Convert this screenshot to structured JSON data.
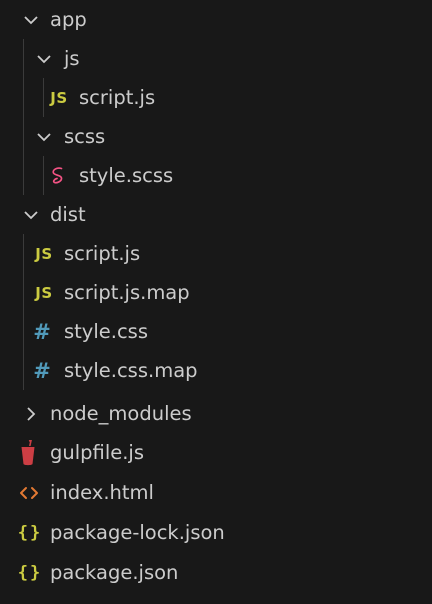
{
  "explorer": {
    "items": [
      {
        "label": "app",
        "type": "folder",
        "state": "expanded",
        "icon": "chevron-down-icon"
      },
      {
        "label": "js",
        "type": "folder",
        "state": "expanded",
        "icon": "chevron-down-icon"
      },
      {
        "label": "script.js",
        "type": "file",
        "icon": "javascript-file-icon",
        "icon_text": "JS"
      },
      {
        "label": "scss",
        "type": "folder",
        "state": "expanded",
        "icon": "chevron-down-icon"
      },
      {
        "label": "style.scss",
        "type": "file",
        "icon": "sass-file-icon"
      },
      {
        "label": "dist",
        "type": "folder",
        "state": "expanded",
        "icon": "chevron-down-icon"
      },
      {
        "label": "script.js",
        "type": "file",
        "icon": "javascript-file-icon",
        "icon_text": "JS"
      },
      {
        "label": "script.js.map",
        "type": "file",
        "icon": "javascript-file-icon",
        "icon_text": "JS"
      },
      {
        "label": "style.css",
        "type": "file",
        "icon": "css-file-icon",
        "icon_text": "#"
      },
      {
        "label": "style.css.map",
        "type": "file",
        "icon": "css-file-icon",
        "icon_text": "#"
      },
      {
        "label": "node_modules",
        "type": "folder",
        "state": "collapsed",
        "icon": "chevron-right-icon"
      },
      {
        "label": "gulpfile.js",
        "type": "file",
        "icon": "gulp-file-icon"
      },
      {
        "label": "index.html",
        "type": "file",
        "icon": "html-file-icon"
      },
      {
        "label": "package-lock.json",
        "type": "file",
        "icon": "json-file-icon",
        "icon_text": "{}"
      },
      {
        "label": "package.json",
        "type": "file",
        "icon": "json-file-icon",
        "icon_text": "{}"
      }
    ]
  },
  "colors": {
    "background": "#181818",
    "text": "#cccccc",
    "indent_guide": "#3b3b3b",
    "javascript": "#cbcb41",
    "css": "#519aba",
    "sass": "#f55385",
    "html": "#e37933",
    "gulp": "#cc3e44",
    "json": "#cbcb41"
  }
}
